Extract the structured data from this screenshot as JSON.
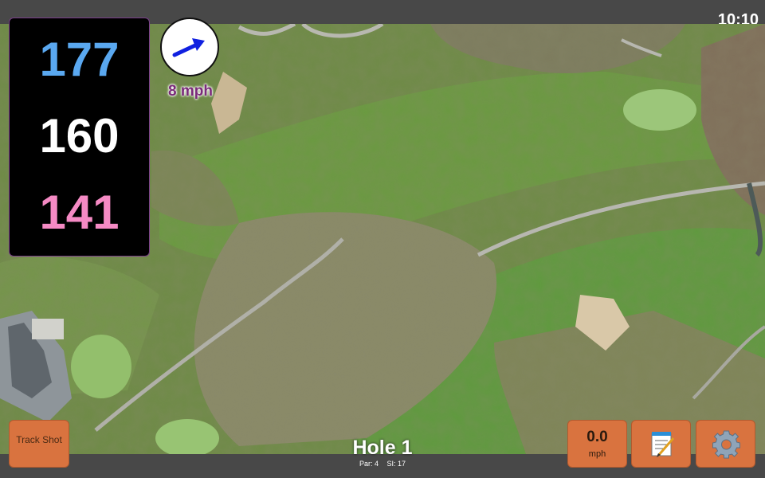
{
  "status": {
    "time": "10:10"
  },
  "distances": {
    "back": "177",
    "center": "160",
    "front": "141"
  },
  "wind": {
    "speed": "8 mph",
    "icon": "wind-arrow-icon",
    "arrow_color": "#1020e0"
  },
  "hole": {
    "title": "Hole 1",
    "par": "Par: 4",
    "si": "SI: 17"
  },
  "buttons": {
    "track_shot": "Track Shot",
    "speed_value": "0.0",
    "speed_unit": "mph",
    "notes_icon": "notepad-icon",
    "settings_icon": "gear-icon"
  },
  "colors": {
    "button": "#d9733f",
    "back_distance": "#5aa8f0",
    "center_distance": "#ffffff",
    "front_distance": "#f58ac4"
  }
}
